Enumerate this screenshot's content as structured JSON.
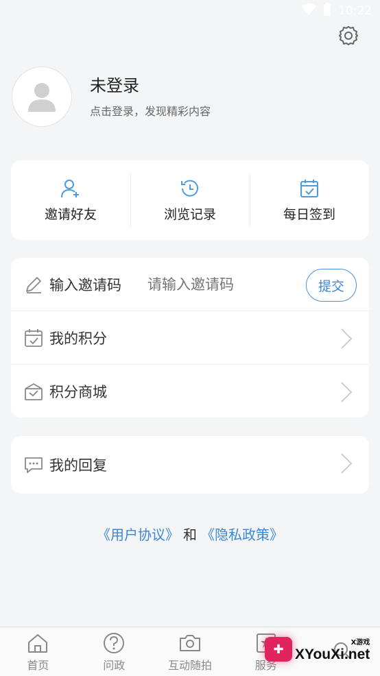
{
  "status": {
    "time": "10:22"
  },
  "profile": {
    "name": "未登录",
    "subtitle": "点击登录，发现精彩内容"
  },
  "quick_actions": [
    {
      "label": "邀请好友",
      "icon": "add-user-icon"
    },
    {
      "label": "浏览记录",
      "icon": "history-icon"
    },
    {
      "label": "每日签到",
      "icon": "calendar-check-icon"
    }
  ],
  "invite": {
    "label": "输入邀请码",
    "placeholder": "请输入邀请码",
    "submit": "提交"
  },
  "menu": [
    {
      "label": "我的积分",
      "icon": "points-calendar-icon"
    },
    {
      "label": "积分商城",
      "icon": "gift-icon"
    }
  ],
  "reply": {
    "label": "我的回复",
    "icon": "chat-bubble-icon"
  },
  "legal": {
    "user_agreement": "《用户协议》",
    "and": "和",
    "privacy": "《隐私政策》"
  },
  "tabs": [
    {
      "label": "首页",
      "icon": "home-icon"
    },
    {
      "label": "问政",
      "icon": "question-icon"
    },
    {
      "label": "互动随拍",
      "icon": "camera-icon"
    },
    {
      "label": "服务",
      "icon": "star-service-icon"
    },
    {
      "label": "",
      "icon": "search-icon"
    }
  ],
  "watermark": {
    "small": "X游戏",
    "big": "XYouXi.net"
  },
  "colors": {
    "accent": "#3b87d6",
    "icon_blue": "#4a9be0",
    "background": "#f4f5f7"
  }
}
